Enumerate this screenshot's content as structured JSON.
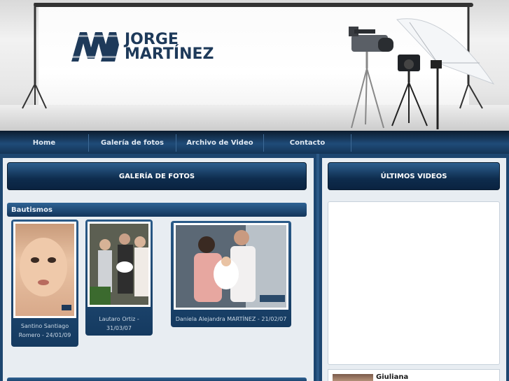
{
  "brand": {
    "line1": "JORGE",
    "line2": "MARTÍNEZ",
    "colors": {
      "logo": "#1e3a5a",
      "nav": "#143557",
      "panel": "#e8edf2"
    }
  },
  "nav": {
    "items": [
      {
        "label": "Home"
      },
      {
        "label": "Galería de fotos"
      },
      {
        "label": "Archivo de Video"
      },
      {
        "label": "Contacto"
      }
    ]
  },
  "gallery": {
    "title": "GALERÍA DE FOTOS",
    "section": "Bautismos",
    "photos": [
      {
        "caption": "Santino Santiago Romero - 24/01/09"
      },
      {
        "caption": "Lautaro Ortiz - 31/03/07"
      },
      {
        "caption": "Daniela Alejandra MARTÍNEZ - 21/02/07"
      }
    ]
  },
  "videos": {
    "title": "ÚLTIMOS VIDEOS",
    "items": [
      {
        "title": "Giuliana"
      }
    ]
  },
  "icons": [
    "logo-mark-icon",
    "light-stand-icon",
    "video-camera-icon",
    "photo-camera-icon",
    "umbrella-light-icon"
  ]
}
